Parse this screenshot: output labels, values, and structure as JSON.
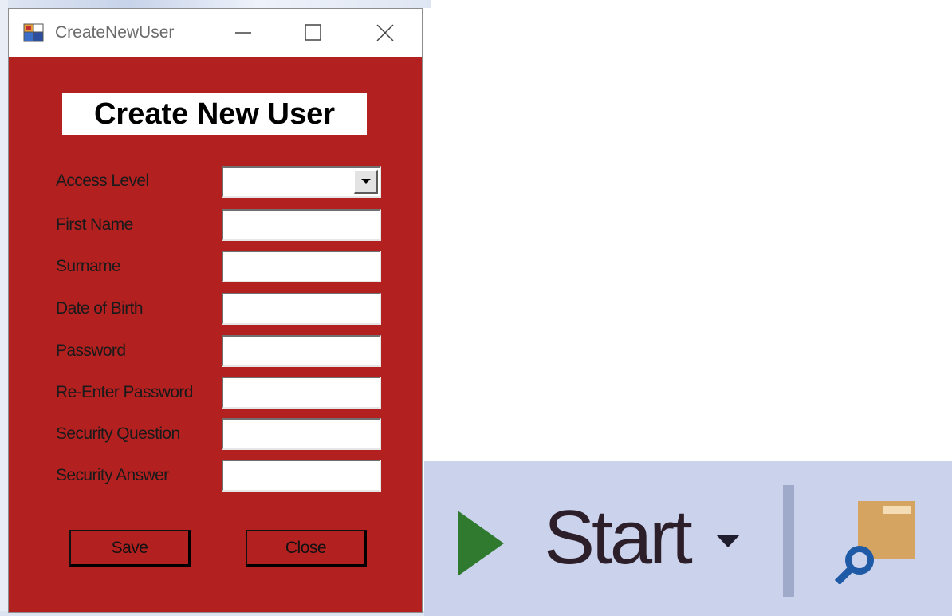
{
  "window": {
    "title": "CreateNewUser",
    "background_color": "#b22020"
  },
  "form": {
    "heading": "Create New User",
    "fields": [
      {
        "label": "Access Level",
        "type": "dropdown",
        "value": ""
      },
      {
        "label": "First Name",
        "type": "text",
        "value": ""
      },
      {
        "label": "Surname",
        "type": "text",
        "value": ""
      },
      {
        "label": "Date of Birth",
        "type": "text",
        "value": ""
      },
      {
        "label": "Password",
        "type": "text",
        "value": ""
      },
      {
        "label": "Re-Enter Password",
        "type": "text",
        "value": ""
      },
      {
        "label": "Security Question",
        "type": "text",
        "value": ""
      },
      {
        "label": "Security Answer",
        "type": "text",
        "value": ""
      }
    ],
    "save_label": "Save",
    "close_label": "Close"
  },
  "toolbar": {
    "start_label": "Start",
    "icons": [
      "play-icon",
      "chevron-down-icon",
      "find-in-folder-icon"
    ]
  }
}
